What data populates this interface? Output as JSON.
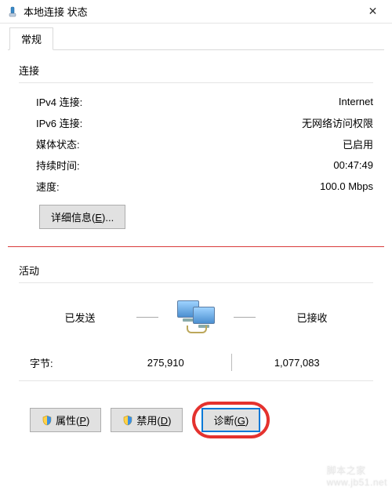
{
  "window": {
    "title": "本地连接 状态",
    "close_glyph": "✕"
  },
  "tabs": {
    "general": "常规"
  },
  "connection": {
    "section_title": "连接",
    "rows": {
      "ipv4_label": "IPv4 连接:",
      "ipv4_value": "Internet",
      "ipv6_label": "IPv6 连接:",
      "ipv6_value": "无网络访问权限",
      "media_label": "媒体状态:",
      "media_value": "已启用",
      "duration_label": "持续时间:",
      "duration_value": "00:47:49",
      "speed_label": "速度:",
      "speed_value": "100.0 Mbps"
    },
    "details_button": "详细信息(E)..."
  },
  "activity": {
    "section_title": "活动",
    "sent_label": "已发送",
    "received_label": "已接收",
    "bytes_label": "字节:",
    "bytes_sent": "275,910",
    "bytes_received": "1,077,083"
  },
  "buttons": {
    "properties": "属性(P)",
    "disable": "禁用(D)",
    "diagnose": "诊断(G)"
  },
  "watermark": {
    "line1": "脚本之家",
    "line2": "www.jb51.net"
  }
}
